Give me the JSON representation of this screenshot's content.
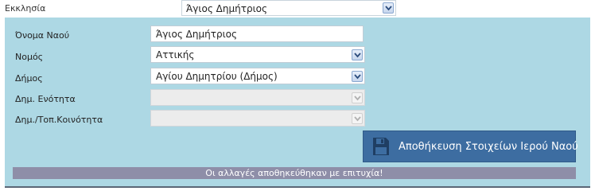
{
  "header": {
    "label": "Εκκλησία",
    "selected": "Άγιος Δημήτριος"
  },
  "form": {
    "name_label": "Όνομα Ναού",
    "name_value": "Άγιος Δημήτριος",
    "prefecture_label": "Νομός",
    "prefecture_value": "Αττικής",
    "municipality_label": "Δήμος",
    "municipality_value": "Αγίου Δημητρίου (Δήμος)",
    "unit_label": "Δημ. Ενότητα",
    "unit_value": "",
    "community_label": "Δημ./Τοπ.Κοινότητα",
    "community_value": ""
  },
  "actions": {
    "save_label": "Αποθήκευση Στοιχείων Ιερού Ναού",
    "save_icon": "floppy-disk-icon"
  },
  "status": {
    "message": "Οι αλλαγές αποθηκεύθηκαν με επιτυχία!"
  },
  "colors": {
    "panel": "#add8e4",
    "button": "#3d6da1",
    "status_bar": "#8e8ea8"
  }
}
